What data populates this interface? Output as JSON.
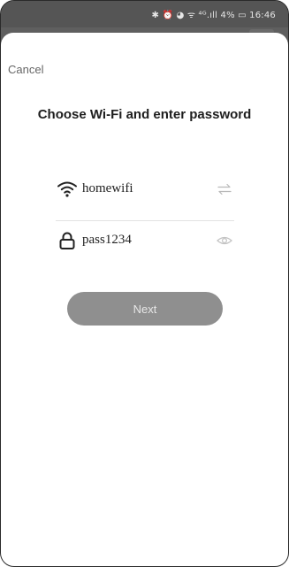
{
  "status_bar": {
    "text": "✱ ⏰ ◕ ᯤ ⁴ᴳ.ıll 4% ▭ 16:46"
  },
  "modal": {
    "cancel_label": "Cancel",
    "title": "Choose Wi-Fi and enter password",
    "wifi": {
      "ssid": "homewifi",
      "icon": "wifi-icon",
      "action_icon": "switch-network-icon"
    },
    "password": {
      "value": "pass1234",
      "icon": "lock-icon",
      "action_icon": "eye-icon"
    },
    "next_label": "Next"
  },
  "colors": {
    "status_bar_bg": "#555555",
    "button_bg": "#8f8f8f",
    "button_text": "#e7e7e7",
    "title_text": "#1e1e1e"
  }
}
